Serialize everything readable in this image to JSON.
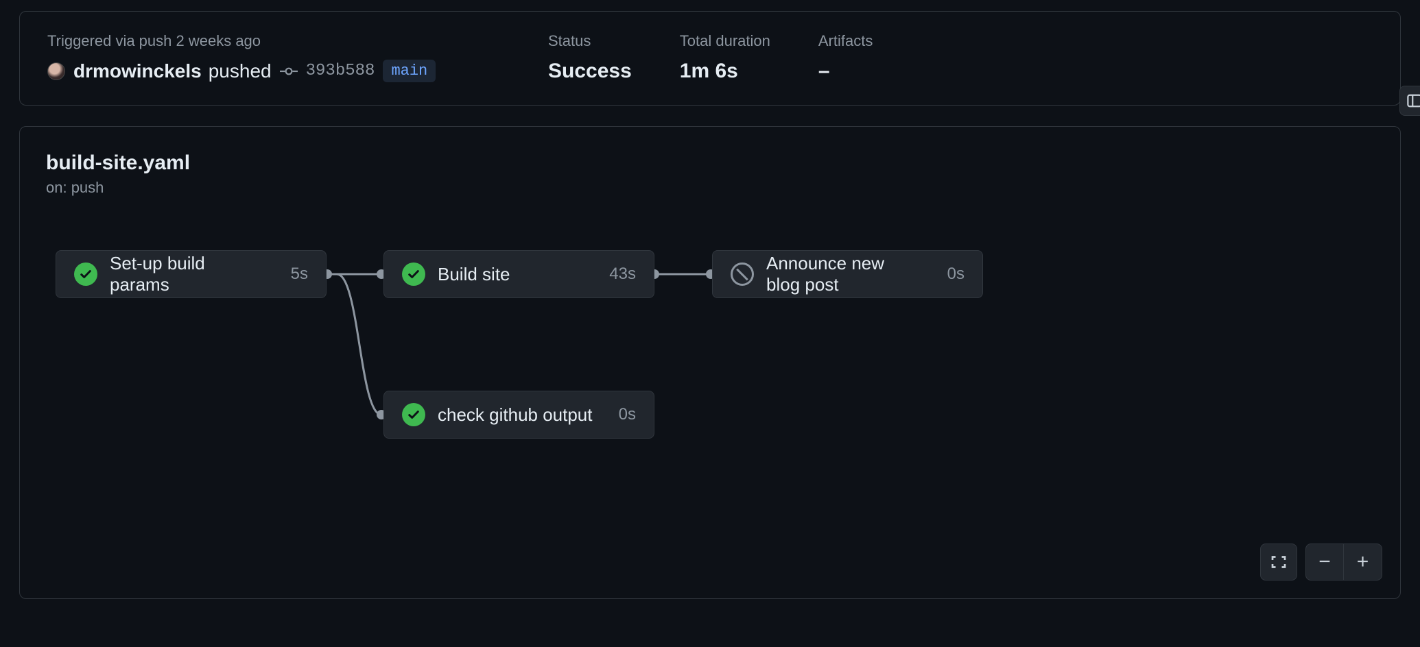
{
  "summary": {
    "trigger_label": "Triggered via push 2 weeks ago",
    "actor": "drmowinckels",
    "push_verb": "pushed",
    "commit_sha": "393b588",
    "branch": "main",
    "status_label": "Status",
    "status_value": "Success",
    "duration_label": "Total duration",
    "duration_value": "1m 6s",
    "artifacts_label": "Artifacts",
    "artifacts_value": "–"
  },
  "workflow": {
    "file": "build-site.yaml",
    "on": "on: push"
  },
  "jobs": [
    {
      "name": "Set-up build params",
      "duration": "5s",
      "status": "success"
    },
    {
      "name": "Build site",
      "duration": "43s",
      "status": "success"
    },
    {
      "name": "Announce new blog post",
      "duration": "0s",
      "status": "skipped"
    },
    {
      "name": "check github output",
      "duration": "0s",
      "status": "success"
    }
  ]
}
